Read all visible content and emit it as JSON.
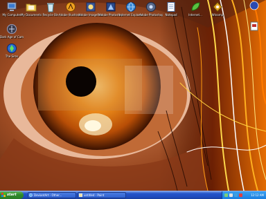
{
  "desktop_icons": {
    "my_computer": "My Computer",
    "my_documents": "My Documents",
    "recycle_bin": "Recycle Bin",
    "illustrator": "Adobe Illustrator CS",
    "imageready": "Adobe ImageReady...",
    "photoshop": "Adobe Photoshop...",
    "internet": "Internet Explorer",
    "photoshop7": "Adobe Photoshop 7.0",
    "notepad": "Notepad",
    "ie_shortcut": "Internet...",
    "winamp": "Winamp",
    "dark_age": "Dark Age of Camelot",
    "sims": "The Sims"
  },
  "taskbar": {
    "start_label": "start",
    "tasks": [
      {
        "label": "DeviantArt - Other..."
      },
      {
        "label": "untitled - Paint"
      }
    ],
    "clock": "12:12 AM"
  },
  "colors": {
    "iris": "#e07a10",
    "taskbar": "#2454c8",
    "start": "#2f8a2b"
  },
  "icons": {
    "start": "windows-flag-icon",
    "task_browser": "browser-icon",
    "task_paint": "paint-icon"
  }
}
